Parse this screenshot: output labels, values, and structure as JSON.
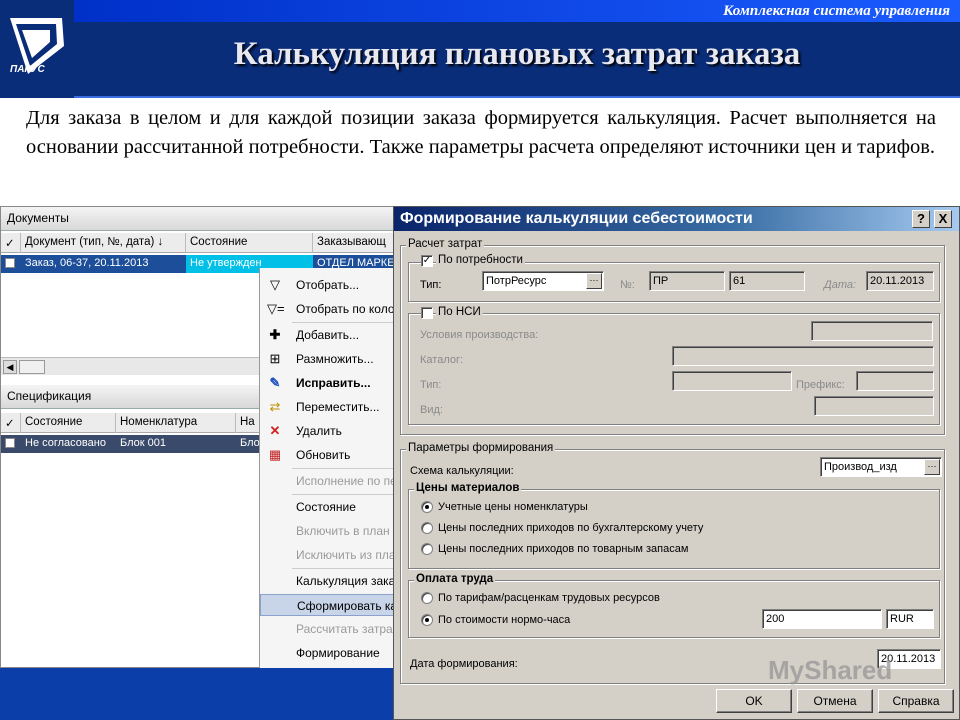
{
  "header": {
    "brand": "Комплексная система управления",
    "logo_text": "ПАРУС",
    "title": "Калькуляция плановых затрат заказа"
  },
  "description": "Для заказа в целом и для каждой позиции заказа формируется калькуляция. Расчет выполняется на основании рассчитанной потребности. Также параметры расчета определяют источники цен и тарифов.",
  "documents": {
    "panel_title": "Документы",
    "columns": [
      "✓",
      "Документ (тип, №, дата)",
      "Состояние",
      "Заказывающ"
    ],
    "row": {
      "document": "Заказ, 06-37, 20.11.2013",
      "state": "Не утвержден",
      "customer": "ОТДЕЛ МАРКЕ"
    }
  },
  "specification": {
    "panel_title": "Спецификация",
    "columns": [
      "✓",
      "Состояние",
      "Номенклатура",
      "На"
    ],
    "row": {
      "state": "Не согласовано",
      "item": "Блок 001",
      "extra": "Бло"
    }
  },
  "context_menu": [
    {
      "label": "Отобрать...",
      "icon": "filter-icon",
      "disabled": false
    },
    {
      "label": "Отобрать по коло",
      "icon": "filter-column-icon",
      "disabled": false
    },
    {
      "label": "Добавить...",
      "icon": "add-icon",
      "disabled": false
    },
    {
      "label": "Размножить...",
      "icon": "duplicate-icon",
      "disabled": false
    },
    {
      "label": "Исправить...",
      "icon": "edit-icon",
      "disabled": false
    },
    {
      "label": "Переместить...",
      "icon": "move-icon",
      "disabled": false
    },
    {
      "label": "Удалить",
      "icon": "delete-icon",
      "disabled": false
    },
    {
      "label": "Обновить",
      "icon": "refresh-icon",
      "disabled": false
    },
    {
      "label": "Исполнение по пе",
      "icon": "",
      "disabled": true
    },
    {
      "label": "Состояние",
      "icon": "",
      "disabled": false
    },
    {
      "label": "Включить в план",
      "icon": "",
      "disabled": true
    },
    {
      "label": "Исключить из пла",
      "icon": "",
      "disabled": true
    },
    {
      "label": "Калькуляция зака",
      "icon": "",
      "disabled": false
    },
    {
      "label": "Сформировать ка",
      "icon": "",
      "disabled": false,
      "selected": true
    },
    {
      "label": "Рассчитать затра",
      "icon": "",
      "disabled": true
    },
    {
      "label": "Формирование",
      "icon": "",
      "disabled": false
    }
  ],
  "dialog": {
    "title": "Формирование калькуляции себестоимости",
    "help_btn": "?",
    "close_btn": "X",
    "cost_calc": {
      "group_label": "Расчет затрат",
      "by_need": {
        "label": "По потребности",
        "checked": true
      },
      "type_label": "Тип:",
      "type_value": "ПотрРесурс",
      "num_label": "№:",
      "num_prefix": "ПР",
      "num_value": "61",
      "date_label": "Дата:",
      "date_value": "20.11.2013",
      "by_nsi": {
        "label": "По НСИ",
        "checked": false
      },
      "conditions_label": "Условия производства:",
      "catalog_label": "Каталог:",
      "type2_label": "Тип:",
      "prefix_label": "Префикс:",
      "kind_label": "Вид:"
    },
    "params": {
      "group_label": "Параметры формирования",
      "scheme_label": "Схема калькуляции:",
      "scheme_value": "Производ_изд",
      "prices": {
        "group_label": "Цены материалов",
        "options": [
          {
            "label": "Учетные цены номенклатуры",
            "selected": true
          },
          {
            "label": "Цены последних приходов по бухгалтерскому учету",
            "selected": false
          },
          {
            "label": "Цены последних приходов по товарным запасам",
            "selected": false
          }
        ]
      },
      "labor": {
        "group_label": "Оплата труда",
        "options": [
          {
            "label": "По тарифам/расценкам трудовых ресурсов",
            "selected": false
          },
          {
            "label": "По стоимости нормо-часа",
            "selected": true
          }
        ],
        "rate_value": "200",
        "currency_value": "RUR"
      },
      "date_label": "Дата формирования:",
      "date_value": "20.11.2013"
    },
    "buttons": {
      "ok": "OK",
      "cancel": "Отмена",
      "help": "Справка"
    }
  },
  "watermark": "MyShared"
}
